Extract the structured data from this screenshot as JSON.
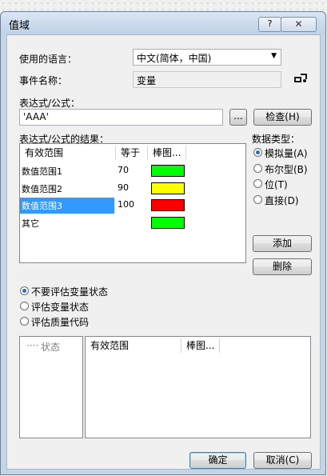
{
  "window": {
    "title": "值域",
    "help_glyph": "?",
    "close_glyph": "✕"
  },
  "language": {
    "label": "使用的语言：",
    "value": "中文(简体，中国)"
  },
  "event_name": {
    "label": "事件名称：",
    "value": "变量"
  },
  "expression": {
    "label": "表达式/公式：",
    "value": "'AAA'",
    "browse_label": "...",
    "check_label": "检查(H)"
  },
  "results": {
    "label": "表达式/公式的结果：",
    "columns": [
      "有效范围",
      "等于",
      "棒图..."
    ],
    "rows": [
      {
        "name": "数值范围1",
        "value": "70",
        "color": "#00ff00"
      },
      {
        "name": "数值范围2",
        "value": "90",
        "color": "#ffff00"
      },
      {
        "name": "数值范围3",
        "value": "100",
        "color": "#ff0000"
      },
      {
        "name": "其它",
        "value": "",
        "color": "#00ff00"
      }
    ],
    "selected_index": 2
  },
  "data_type": {
    "label": "数据类型：",
    "options": [
      "模拟量(A)",
      "布尔型(B)",
      "位(T)",
      "直接(D)"
    ],
    "selected_index": 0
  },
  "buttons": {
    "add": "添加",
    "delete": "删除",
    "ok": "确定",
    "cancel": "取消(C)"
  },
  "eval": {
    "options": [
      "不要评估变量状态",
      "评估变量状态",
      "评估质量代码"
    ],
    "selected_index": 0
  },
  "bottom": {
    "tree_item": "状态",
    "columns": [
      "有效范围",
      "棒图..."
    ]
  }
}
